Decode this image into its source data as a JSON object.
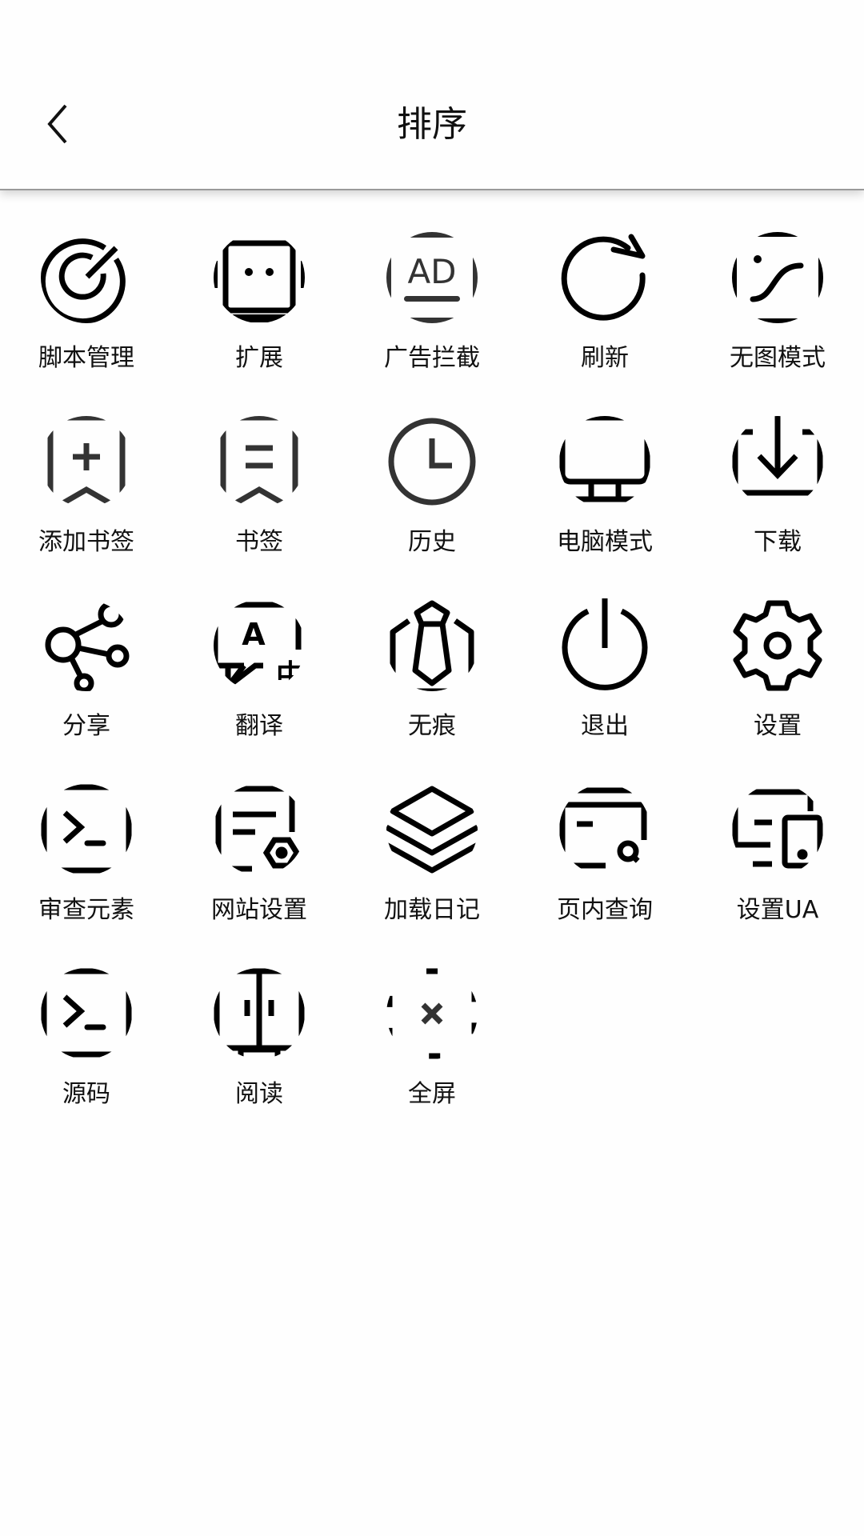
{
  "header": {
    "title": "排序",
    "back_icon": "chevron-left-icon"
  },
  "menu": {
    "items": [
      {
        "label": "脚本管理",
        "icon": "script-radar-icon"
      },
      {
        "label": "扩展",
        "icon": "extension-robot-icon"
      },
      {
        "label": "广告拦截",
        "icon": "ad-block-icon"
      },
      {
        "label": "刷新",
        "icon": "refresh-icon"
      },
      {
        "label": "无图模式",
        "icon": "no-image-icon"
      },
      {
        "label": "添加书签",
        "icon": "bookmark-add-icon"
      },
      {
        "label": "书签",
        "icon": "bookmark-icon"
      },
      {
        "label": "历史",
        "icon": "clock-icon"
      },
      {
        "label": "电脑模式",
        "icon": "desktop-monitor-icon"
      },
      {
        "label": "下载",
        "icon": "download-icon"
      },
      {
        "label": "分享",
        "icon": "share-icon"
      },
      {
        "label": "翻译",
        "icon": "translate-icon"
      },
      {
        "label": "无痕",
        "icon": "incognito-tie-icon"
      },
      {
        "label": "退出",
        "icon": "power-icon"
      },
      {
        "label": "设置",
        "icon": "gear-icon"
      },
      {
        "label": "审查元素",
        "icon": "terminal-icon"
      },
      {
        "label": "网站设置",
        "icon": "site-settings-icon"
      },
      {
        "label": "加载日记",
        "icon": "layers-icon"
      },
      {
        "label": "页内查询",
        "icon": "find-in-page-icon"
      },
      {
        "label": "设置UA",
        "icon": "devices-icon"
      },
      {
        "label": "源码",
        "icon": "terminal-icon"
      },
      {
        "label": "阅读",
        "icon": "reading-book-icon"
      },
      {
        "label": "全屏",
        "icon": "fullscreen-exit-icon"
      }
    ]
  }
}
